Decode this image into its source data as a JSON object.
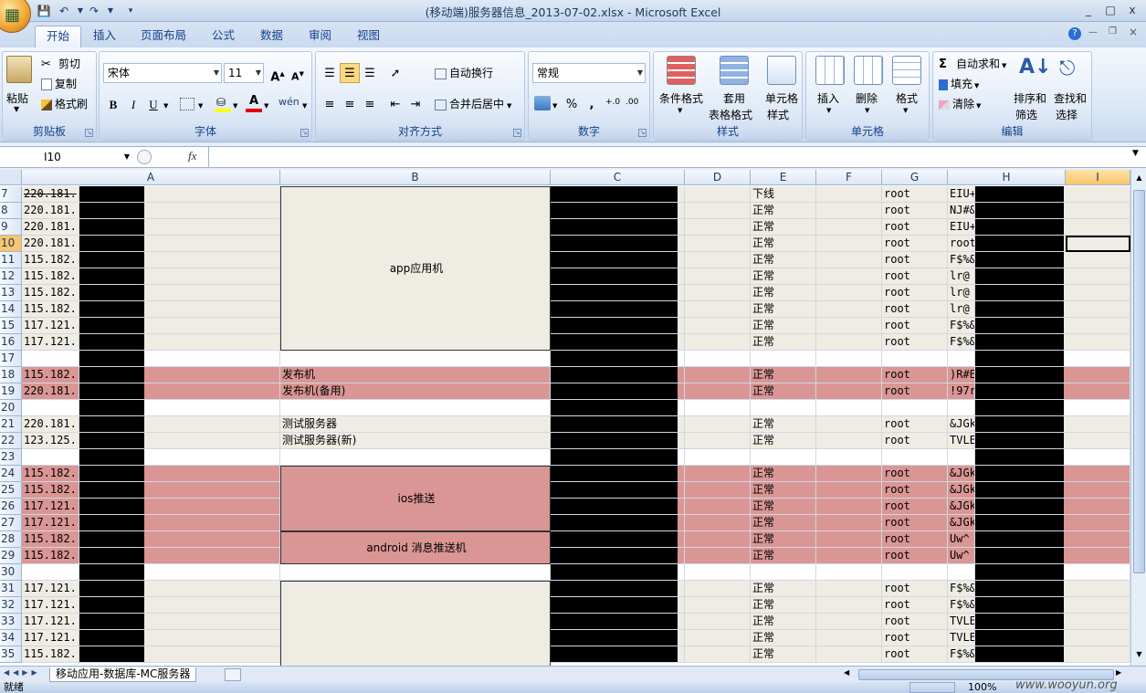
{
  "window": {
    "title": "(移动端)服务器信息_2013-07-02.xlsx - Microsoft Excel",
    "controls": [
      "_",
      "□",
      "x"
    ]
  },
  "ribbon": {
    "tabs": [
      "开始",
      "插入",
      "页面布局",
      "公式",
      "数据",
      "审阅",
      "视图"
    ],
    "active_tab": "开始",
    "clipboard": {
      "paste": "粘贴",
      "cut": "剪切",
      "copy": "复制",
      "format_painter": "格式刷",
      "label": "剪贴板"
    },
    "font": {
      "name": "宋体",
      "size": "11",
      "grow": "A",
      "shrink": "A",
      "bold": "B",
      "italic": "I",
      "underline": "U",
      "phonetic": "wén",
      "label": "字体"
    },
    "alignment": {
      "wrap": "自动换行",
      "merge": "合并后居中",
      "label": "对齐方式"
    },
    "number": {
      "format": "常规",
      "percent": "%",
      "comma": ",",
      "label": "数字"
    },
    "styles": {
      "conditional": "条件格式",
      "table_format_1": "套用",
      "table_format_2": "表格格式",
      "cell_styles_1": "单元格",
      "cell_styles_2": "样式",
      "label": "样式"
    },
    "cells": {
      "insert": "插入",
      "delete": "删除",
      "format": "格式",
      "label": "单元格"
    },
    "editing": {
      "autosum": "自动求和",
      "fill": "填充",
      "clear": "清除",
      "sort_1": "排序和",
      "sort_2": "筛选",
      "find_1": "查找和",
      "find_2": "选择",
      "label": "编辑"
    }
  },
  "formula_bar": {
    "name_box": "I10",
    "fx": "fx",
    "content": ""
  },
  "grid": {
    "columns": [
      "A",
      "B",
      "C",
      "D",
      "E",
      "F",
      "G",
      "H",
      "I"
    ],
    "selected_column": "I",
    "selected_row": "10",
    "rows": [
      {
        "n": "7",
        "a": "220.181.",
        "b": "",
        "e": "下线",
        "g": "root",
        "h": "EIU+",
        "fill": "#efece3"
      },
      {
        "n": "8",
        "a": "220.181.",
        "b": "",
        "e": "正常",
        "g": "root",
        "h": "NJ#&",
        "fill": "#efece3"
      },
      {
        "n": "9",
        "a": "220.181.",
        "b": "",
        "e": "正常",
        "g": "root",
        "h": "EIU+",
        "fill": "#efece3"
      },
      {
        "n": "10",
        "a": "220.181.",
        "b": "",
        "e": "正常",
        "g": "root",
        "h": "root",
        "fill": "#efece3"
      },
      {
        "n": "11",
        "a": "115.182.",
        "b": "",
        "e": "正常",
        "g": "root",
        "h": "F$%&",
        "fill": "#efece3"
      },
      {
        "n": "12",
        "a": "115.182.",
        "b": "",
        "e": "正常",
        "g": "root",
        "h": "lr@",
        "fill": "#efece3"
      },
      {
        "n": "13",
        "a": "115.182.",
        "b": "",
        "e": "正常",
        "g": "root",
        "h": "lr@",
        "fill": "#efece3"
      },
      {
        "n": "14",
        "a": "115.182.",
        "b": "",
        "e": "正常",
        "g": "root",
        "h": "lr@",
        "fill": "#efece3"
      },
      {
        "n": "15",
        "a": "117.121.",
        "b": "",
        "e": "正常",
        "g": "root",
        "h": "F$%&",
        "fill": "#efece3"
      },
      {
        "n": "16",
        "a": "117.121.",
        "b": "",
        "e": "正常",
        "g": "root",
        "h": "F$%&",
        "fill": "#efece3"
      },
      {
        "n": "17",
        "a": "",
        "b": "",
        "e": "",
        "g": "",
        "h": "",
        "fill": "#ffffff"
      },
      {
        "n": "18",
        "a": "115.182.",
        "b": "发布机",
        "e": "正常",
        "g": "root",
        "h": ")R#E",
        "fill": "#da9694"
      },
      {
        "n": "19",
        "a": "220.181.",
        "b": "发布机(备用)",
        "e": "正常",
        "g": "root",
        "h": "!97r",
        "fill": "#da9694"
      },
      {
        "n": "20",
        "a": "",
        "b": "",
        "e": "",
        "g": "",
        "h": "",
        "fill": "#ffffff"
      },
      {
        "n": "21",
        "a": "220.181.",
        "b": "测试服务器",
        "e": "正常",
        "g": "root",
        "h": "&JGk",
        "fill": "#efece3"
      },
      {
        "n": "22",
        "a": "123.125.",
        "b": "测试服务器(新)",
        "e": "正常",
        "g": "root",
        "h": "TVLE",
        "fill": "#efece3"
      },
      {
        "n": "23",
        "a": "",
        "b": "",
        "e": "",
        "g": "",
        "h": "",
        "fill": "#ffffff"
      },
      {
        "n": "24",
        "a": "115.182.",
        "b": "",
        "e": "正常",
        "g": "root",
        "h": "&JGk",
        "fill": "#da9694"
      },
      {
        "n": "25",
        "a": "115.182.",
        "b": "",
        "e": "正常",
        "g": "root",
        "h": "&JGk",
        "fill": "#da9694"
      },
      {
        "n": "26",
        "a": "117.121.",
        "b": "",
        "e": "正常",
        "g": "root",
        "h": "&JGk",
        "fill": "#da9694"
      },
      {
        "n": "27",
        "a": "117.121.",
        "b": "",
        "e": "正常",
        "g": "root",
        "h": "&JGk",
        "fill": "#da9694"
      },
      {
        "n": "28",
        "a": "115.182.",
        "b": "",
        "e": "正常",
        "g": "root",
        "h": "Uw^",
        "fill": "#da9694"
      },
      {
        "n": "29",
        "a": "115.182.",
        "b": "",
        "e": "正常",
        "g": "root",
        "h": "Uw^",
        "fill": "#da9694"
      },
      {
        "n": "30",
        "a": "",
        "b": "",
        "e": "",
        "g": "",
        "h": "",
        "fill": "#ffffff"
      },
      {
        "n": "31",
        "a": "117.121.",
        "b": "",
        "e": "正常",
        "g": "root",
        "h": "F$%&",
        "fill": "#efece3"
      },
      {
        "n": "32",
        "a": "117.121.",
        "b": "",
        "e": "正常",
        "g": "root",
        "h": "F$%&",
        "fill": "#efece3"
      },
      {
        "n": "33",
        "a": "117.121.",
        "b": "",
        "e": "正常",
        "g": "root",
        "h": "TVLE",
        "fill": "#efece3"
      },
      {
        "n": "34",
        "a": "117.121.",
        "b": "",
        "e": "正常",
        "g": "root",
        "h": "TVLE",
        "fill": "#efece3"
      },
      {
        "n": "35",
        "a": "115.182.",
        "b": "",
        "e": "正常",
        "g": "root",
        "h": "F$%&",
        "fill": "#efece3"
      }
    ],
    "merged_labels": {
      "app": "app应用机",
      "ios": "ios推送",
      "android": "android 消息推送机"
    }
  },
  "sheet": {
    "tab": "移动应用-数据库-MC服务器"
  },
  "status": {
    "ready": "就绪",
    "zoom": "100%",
    "watermark": "www.wooyun.org"
  },
  "colors": {
    "beige": "#efece3",
    "rose": "#da9694",
    "redact": "#000000"
  }
}
